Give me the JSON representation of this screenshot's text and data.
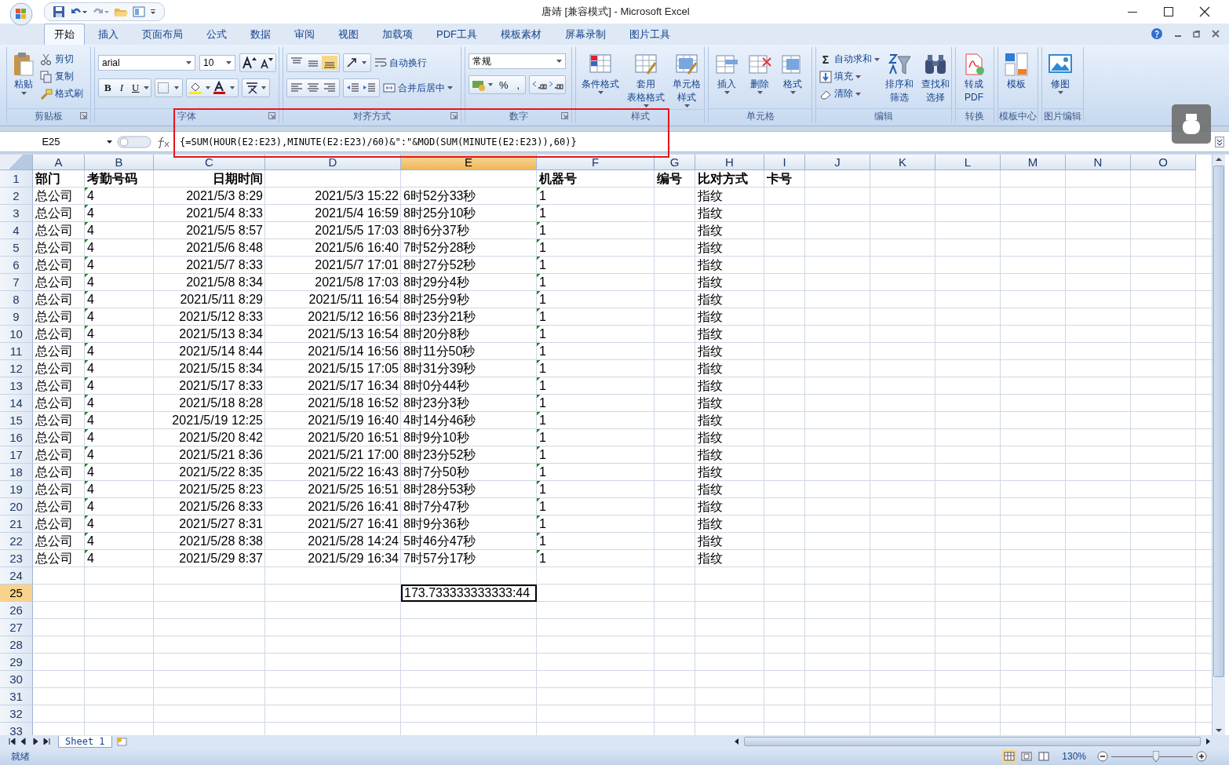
{
  "window": {
    "title": "唐靖  [兼容模式] - Microsoft Excel"
  },
  "ribbon_tabs": [
    {
      "label": "开始",
      "selected": true
    },
    {
      "label": "插入",
      "selected": false
    },
    {
      "label": "页面布局",
      "selected": false
    },
    {
      "label": "公式",
      "selected": false
    },
    {
      "label": "数据",
      "selected": false
    },
    {
      "label": "审阅",
      "selected": false
    },
    {
      "label": "视图",
      "selected": false
    },
    {
      "label": "加载项",
      "selected": false
    },
    {
      "label": "PDF工具",
      "selected": false
    },
    {
      "label": "模板素材",
      "selected": false
    },
    {
      "label": "屏幕录制",
      "selected": false
    },
    {
      "label": "图片工具",
      "selected": false
    }
  ],
  "ribbon": {
    "clipboard": {
      "label": "剪贴板",
      "paste": "粘贴",
      "small": [
        "剪切",
        "复制",
        "格式刷"
      ]
    },
    "font": {
      "label": "字体",
      "font_name": "arial",
      "font_size": "10",
      "style_buttons": [
        "B",
        "I",
        "U"
      ]
    },
    "alignment": {
      "label": "对齐方式",
      "wrap": "自动换行",
      "merge": "合并后居中"
    },
    "number": {
      "label": "数字",
      "format": "常规",
      "symbols": [
        "%",
        ","
      ]
    },
    "styles": {
      "label": "样式",
      "buttons": [
        {
          "lines": [
            "条件格式"
          ]
        },
        {
          "lines": [
            "套用",
            "表格格式"
          ]
        },
        {
          "lines": [
            "单元格",
            "样式"
          ]
        }
      ]
    },
    "cells": {
      "label": "单元格",
      "buttons": [
        "插入",
        "删除",
        "格式"
      ]
    },
    "editing": {
      "label": "编辑",
      "sum_symbol": "Σ",
      "small": [
        "自动求和",
        "填充",
        "清除"
      ],
      "buttons": [
        {
          "lines": [
            "排序和",
            "筛选"
          ]
        },
        {
          "lines": [
            "查找和",
            "选择"
          ]
        }
      ]
    },
    "convert": {
      "label": "转换",
      "lines": [
        "转成",
        "PDF"
      ]
    },
    "templates": {
      "label": "模板中心",
      "text": "模板"
    },
    "picture_edit": {
      "label": "图片编辑",
      "text": "修图"
    }
  },
  "formula_bar": {
    "name_box": "E25",
    "formula": "{=SUM(HOUR(E2:E23),MINUTE(E2:E23)/60)&\":\"&MOD(SUM(MINUTE(E2:E23)),60)}"
  },
  "columns": [
    {
      "label": "A",
      "selected": false
    },
    {
      "label": "B",
      "selected": false
    },
    {
      "label": "C",
      "selected": false
    },
    {
      "label": "D",
      "selected": false
    },
    {
      "label": "E",
      "selected": true
    },
    {
      "label": "F",
      "selected": false
    },
    {
      "label": "G",
      "selected": false
    },
    {
      "label": "H",
      "selected": false
    },
    {
      "label": "I",
      "selected": false
    },
    {
      "label": "J",
      "selected": false
    },
    {
      "label": "K",
      "selected": false
    },
    {
      "label": "L",
      "selected": false
    },
    {
      "label": "M",
      "selected": false
    },
    {
      "label": "N",
      "selected": false
    },
    {
      "label": "O",
      "selected": false
    }
  ],
  "rows": [
    {
      "number": "1",
      "selected": false,
      "cells": {
        "A": {
          "text": "部门",
          "flagged": false
        },
        "B": {
          "text": "考勤号码",
          "flagged": false
        },
        "C": {
          "text": "日期时间",
          "flagged": false
        },
        "F": {
          "text": "机器号",
          "flagged": false
        },
        "G": {
          "text": "编号",
          "flagged": false
        },
        "H": {
          "text": "比对方式",
          "flagged": false
        },
        "I": {
          "text": "卡号",
          "flagged": false
        }
      }
    },
    {
      "number": "2",
      "selected": false,
      "cells": {
        "A": {
          "text": "总公司",
          "flagged": false
        },
        "B": {
          "text": "4",
          "flagged": true
        },
        "C": {
          "text": "2021/5/3 8:29",
          "flagged": false
        },
        "D": {
          "text": "2021/5/3 15:22",
          "flagged": false
        },
        "E": {
          "text": "6时52分33秒",
          "flagged": false
        },
        "F": {
          "text": "1",
          "flagged": true
        },
        "H": {
          "text": "指纹",
          "flagged": false
        }
      }
    },
    {
      "number": "3",
      "selected": false,
      "cells": {
        "A": {
          "text": "总公司",
          "flagged": false
        },
        "B": {
          "text": "4",
          "flagged": true
        },
        "C": {
          "text": "2021/5/4 8:33",
          "flagged": false
        },
        "D": {
          "text": "2021/5/4 16:59",
          "flagged": false
        },
        "E": {
          "text": "8时25分10秒",
          "flagged": false
        },
        "F": {
          "text": "1",
          "flagged": true
        },
        "H": {
          "text": "指纹",
          "flagged": false
        }
      }
    },
    {
      "number": "4",
      "selected": false,
      "cells": {
        "A": {
          "text": "总公司",
          "flagged": false
        },
        "B": {
          "text": "4",
          "flagged": true
        },
        "C": {
          "text": "2021/5/5 8:57",
          "flagged": false
        },
        "D": {
          "text": "2021/5/5 17:03",
          "flagged": false
        },
        "E": {
          "text": "8时6分37秒",
          "flagged": false
        },
        "F": {
          "text": "1",
          "flagged": true
        },
        "H": {
          "text": "指纹",
          "flagged": false
        }
      }
    },
    {
      "number": "5",
      "selected": false,
      "cells": {
        "A": {
          "text": "总公司",
          "flagged": false
        },
        "B": {
          "text": "4",
          "flagged": true
        },
        "C": {
          "text": "2021/5/6 8:48",
          "flagged": false
        },
        "D": {
          "text": "2021/5/6 16:40",
          "flagged": false
        },
        "E": {
          "text": "7时52分28秒",
          "flagged": false
        },
        "F": {
          "text": "1",
          "flagged": true
        },
        "H": {
          "text": "指纹",
          "flagged": false
        }
      }
    },
    {
      "number": "6",
      "selected": false,
      "cells": {
        "A": {
          "text": "总公司",
          "flagged": false
        },
        "B": {
          "text": "4",
          "flagged": true
        },
        "C": {
          "text": "2021/5/7 8:33",
          "flagged": false
        },
        "D": {
          "text": "2021/5/7 17:01",
          "flagged": false
        },
        "E": {
          "text": "8时27分52秒",
          "flagged": false
        },
        "F": {
          "text": "1",
          "flagged": true
        },
        "H": {
          "text": "指纹",
          "flagged": false
        }
      }
    },
    {
      "number": "7",
      "selected": false,
      "cells": {
        "A": {
          "text": "总公司",
          "flagged": false
        },
        "B": {
          "text": "4",
          "flagged": true
        },
        "C": {
          "text": "2021/5/8 8:34",
          "flagged": false
        },
        "D": {
          "text": "2021/5/8 17:03",
          "flagged": false
        },
        "E": {
          "text": "8时29分4秒",
          "flagged": false
        },
        "F": {
          "text": "1",
          "flagged": true
        },
        "H": {
          "text": "指纹",
          "flagged": false
        }
      }
    },
    {
      "number": "8",
      "selected": false,
      "cells": {
        "A": {
          "text": "总公司",
          "flagged": false
        },
        "B": {
          "text": "4",
          "flagged": true
        },
        "C": {
          "text": "2021/5/11 8:29",
          "flagged": false
        },
        "D": {
          "text": "2021/5/11 16:54",
          "flagged": false
        },
        "E": {
          "text": "8时25分9秒",
          "flagged": false
        },
        "F": {
          "text": "1",
          "flagged": true
        },
        "H": {
          "text": "指纹",
          "flagged": false
        }
      }
    },
    {
      "number": "9",
      "selected": false,
      "cells": {
        "A": {
          "text": "总公司",
          "flagged": false
        },
        "B": {
          "text": "4",
          "flagged": true
        },
        "C": {
          "text": "2021/5/12 8:33",
          "flagged": false
        },
        "D": {
          "text": "2021/5/12 16:56",
          "flagged": false
        },
        "E": {
          "text": "8时23分21秒",
          "flagged": false
        },
        "F": {
          "text": "1",
          "flagged": true
        },
        "H": {
          "text": "指纹",
          "flagged": false
        }
      }
    },
    {
      "number": "10",
      "selected": false,
      "cells": {
        "A": {
          "text": "总公司",
          "flagged": false
        },
        "B": {
          "text": "4",
          "flagged": true
        },
        "C": {
          "text": "2021/5/13 8:34",
          "flagged": false
        },
        "D": {
          "text": "2021/5/13 16:54",
          "flagged": false
        },
        "E": {
          "text": "8时20分8秒",
          "flagged": false
        },
        "F": {
          "text": "1",
          "flagged": true
        },
        "H": {
          "text": "指纹",
          "flagged": false
        }
      }
    },
    {
      "number": "11",
      "selected": false,
      "cells": {
        "A": {
          "text": "总公司",
          "flagged": false
        },
        "B": {
          "text": "4",
          "flagged": true
        },
        "C": {
          "text": "2021/5/14 8:44",
          "flagged": false
        },
        "D": {
          "text": "2021/5/14 16:56",
          "flagged": false
        },
        "E": {
          "text": "8时11分50秒",
          "flagged": false
        },
        "F": {
          "text": "1",
          "flagged": true
        },
        "H": {
          "text": "指纹",
          "flagged": false
        }
      }
    },
    {
      "number": "12",
      "selected": false,
      "cells": {
        "A": {
          "text": "总公司",
          "flagged": false
        },
        "B": {
          "text": "4",
          "flagged": true
        },
        "C": {
          "text": "2021/5/15 8:34",
          "flagged": false
        },
        "D": {
          "text": "2021/5/15 17:05",
          "flagged": false
        },
        "E": {
          "text": "8时31分39秒",
          "flagged": false
        },
        "F": {
          "text": "1",
          "flagged": true
        },
        "H": {
          "text": "指纹",
          "flagged": false
        }
      }
    },
    {
      "number": "13",
      "selected": false,
      "cells": {
        "A": {
          "text": "总公司",
          "flagged": false
        },
        "B": {
          "text": "4",
          "flagged": true
        },
        "C": {
          "text": "2021/5/17 8:33",
          "flagged": false
        },
        "D": {
          "text": "2021/5/17 16:34",
          "flagged": false
        },
        "E": {
          "text": "8时0分44秒",
          "flagged": false
        },
        "F": {
          "text": "1",
          "flagged": true
        },
        "H": {
          "text": "指纹",
          "flagged": false
        }
      }
    },
    {
      "number": "14",
      "selected": false,
      "cells": {
        "A": {
          "text": "总公司",
          "flagged": false
        },
        "B": {
          "text": "4",
          "flagged": true
        },
        "C": {
          "text": "2021/5/18 8:28",
          "flagged": false
        },
        "D": {
          "text": "2021/5/18 16:52",
          "flagged": false
        },
        "E": {
          "text": "8时23分3秒",
          "flagged": false
        },
        "F": {
          "text": "1",
          "flagged": true
        },
        "H": {
          "text": "指纹",
          "flagged": false
        }
      }
    },
    {
      "number": "15",
      "selected": false,
      "cells": {
        "A": {
          "text": "总公司",
          "flagged": false
        },
        "B": {
          "text": "4",
          "flagged": true
        },
        "C": {
          "text": "2021/5/19 12:25",
          "flagged": false
        },
        "D": {
          "text": "2021/5/19 16:40",
          "flagged": false
        },
        "E": {
          "text": "4时14分46秒",
          "flagged": false
        },
        "F": {
          "text": "1",
          "flagged": true
        },
        "H": {
          "text": "指纹",
          "flagged": false
        }
      }
    },
    {
      "number": "16",
      "selected": false,
      "cells": {
        "A": {
          "text": "总公司",
          "flagged": false
        },
        "B": {
          "text": "4",
          "flagged": true
        },
        "C": {
          "text": "2021/5/20 8:42",
          "flagged": false
        },
        "D": {
          "text": "2021/5/20 16:51",
          "flagged": false
        },
        "E": {
          "text": "8时9分10秒",
          "flagged": false
        },
        "F": {
          "text": "1",
          "flagged": true
        },
        "H": {
          "text": "指纹",
          "flagged": false
        }
      }
    },
    {
      "number": "17",
      "selected": false,
      "cells": {
        "A": {
          "text": "总公司",
          "flagged": false
        },
        "B": {
          "text": "4",
          "flagged": true
        },
        "C": {
          "text": "2021/5/21 8:36",
          "flagged": false
        },
        "D": {
          "text": "2021/5/21 17:00",
          "flagged": false
        },
        "E": {
          "text": "8时23分52秒",
          "flagged": false
        },
        "F": {
          "text": "1",
          "flagged": true
        },
        "H": {
          "text": "指纹",
          "flagged": false
        }
      }
    },
    {
      "number": "18",
      "selected": false,
      "cells": {
        "A": {
          "text": "总公司",
          "flagged": false
        },
        "B": {
          "text": "4",
          "flagged": true
        },
        "C": {
          "text": "2021/5/22 8:35",
          "flagged": false
        },
        "D": {
          "text": "2021/5/22 16:43",
          "flagged": false
        },
        "E": {
          "text": "8时7分50秒",
          "flagged": false
        },
        "F": {
          "text": "1",
          "flagged": true
        },
        "H": {
          "text": "指纹",
          "flagged": false
        }
      }
    },
    {
      "number": "19",
      "selected": false,
      "cells": {
        "A": {
          "text": "总公司",
          "flagged": false
        },
        "B": {
          "text": "4",
          "flagged": true
        },
        "C": {
          "text": "2021/5/25 8:23",
          "flagged": false
        },
        "D": {
          "text": "2021/5/25 16:51",
          "flagged": false
        },
        "E": {
          "text": "8时28分53秒",
          "flagged": false
        },
        "F": {
          "text": "1",
          "flagged": true
        },
        "H": {
          "text": "指纹",
          "flagged": false
        }
      }
    },
    {
      "number": "20",
      "selected": false,
      "cells": {
        "A": {
          "text": "总公司",
          "flagged": false
        },
        "B": {
          "text": "4",
          "flagged": true
        },
        "C": {
          "text": "2021/5/26 8:33",
          "flagged": false
        },
        "D": {
          "text": "2021/5/26 16:41",
          "flagged": false
        },
        "E": {
          "text": "8时7分47秒",
          "flagged": false
        },
        "F": {
          "text": "1",
          "flagged": true
        },
        "H": {
          "text": "指纹",
          "flagged": false
        }
      }
    },
    {
      "number": "21",
      "selected": false,
      "cells": {
        "A": {
          "text": "总公司",
          "flagged": false
        },
        "B": {
          "text": "4",
          "flagged": true
        },
        "C": {
          "text": "2021/5/27 8:31",
          "flagged": false
        },
        "D": {
          "text": "2021/5/27 16:41",
          "flagged": false
        },
        "E": {
          "text": "8时9分36秒",
          "flagged": false
        },
        "F": {
          "text": "1",
          "flagged": true
        },
        "H": {
          "text": "指纹",
          "flagged": false
        }
      }
    },
    {
      "number": "22",
      "selected": false,
      "cells": {
        "A": {
          "text": "总公司",
          "flagged": false
        },
        "B": {
          "text": "4",
          "flagged": true
        },
        "C": {
          "text": "2021/5/28 8:38",
          "flagged": false
        },
        "D": {
          "text": "2021/5/28 14:24",
          "flagged": false
        },
        "E": {
          "text": "5时46分47秒",
          "flagged": false
        },
        "F": {
          "text": "1",
          "flagged": true
        },
        "H": {
          "text": "指纹",
          "flagged": false
        }
      }
    },
    {
      "number": "23",
      "selected": false,
      "cells": {
        "A": {
          "text": "总公司",
          "flagged": false
        },
        "B": {
          "text": "4",
          "flagged": true
        },
        "C": {
          "text": "2021/5/29 8:37",
          "flagged": false
        },
        "D": {
          "text": "2021/5/29 16:34",
          "flagged": false
        },
        "E": {
          "text": "7时57分17秒",
          "flagged": false
        },
        "F": {
          "text": "1",
          "flagged": true
        },
        "H": {
          "text": "指纹",
          "flagged": false
        }
      }
    },
    {
      "number": "24",
      "selected": false
    },
    {
      "number": "25",
      "selected": true,
      "cells": {
        "E": {
          "text": "173.733333333333:44",
          "flagged": false
        }
      }
    },
    {
      "number": "26",
      "selected": false
    },
    {
      "number": "27",
      "selected": false
    },
    {
      "number": "28",
      "selected": false
    },
    {
      "number": "29",
      "selected": false
    },
    {
      "number": "30",
      "selected": false
    },
    {
      "number": "31",
      "selected": false
    },
    {
      "number": "32",
      "selected": false
    },
    {
      "number": "33",
      "selected": false
    }
  ],
  "sheet_tabs": [
    {
      "label": "Sheet 1",
      "selected": true
    }
  ],
  "status_bar": {
    "status": "就绪",
    "zoom": "130%",
    "zoom_slider": {
      "level": 0.55
    }
  }
}
